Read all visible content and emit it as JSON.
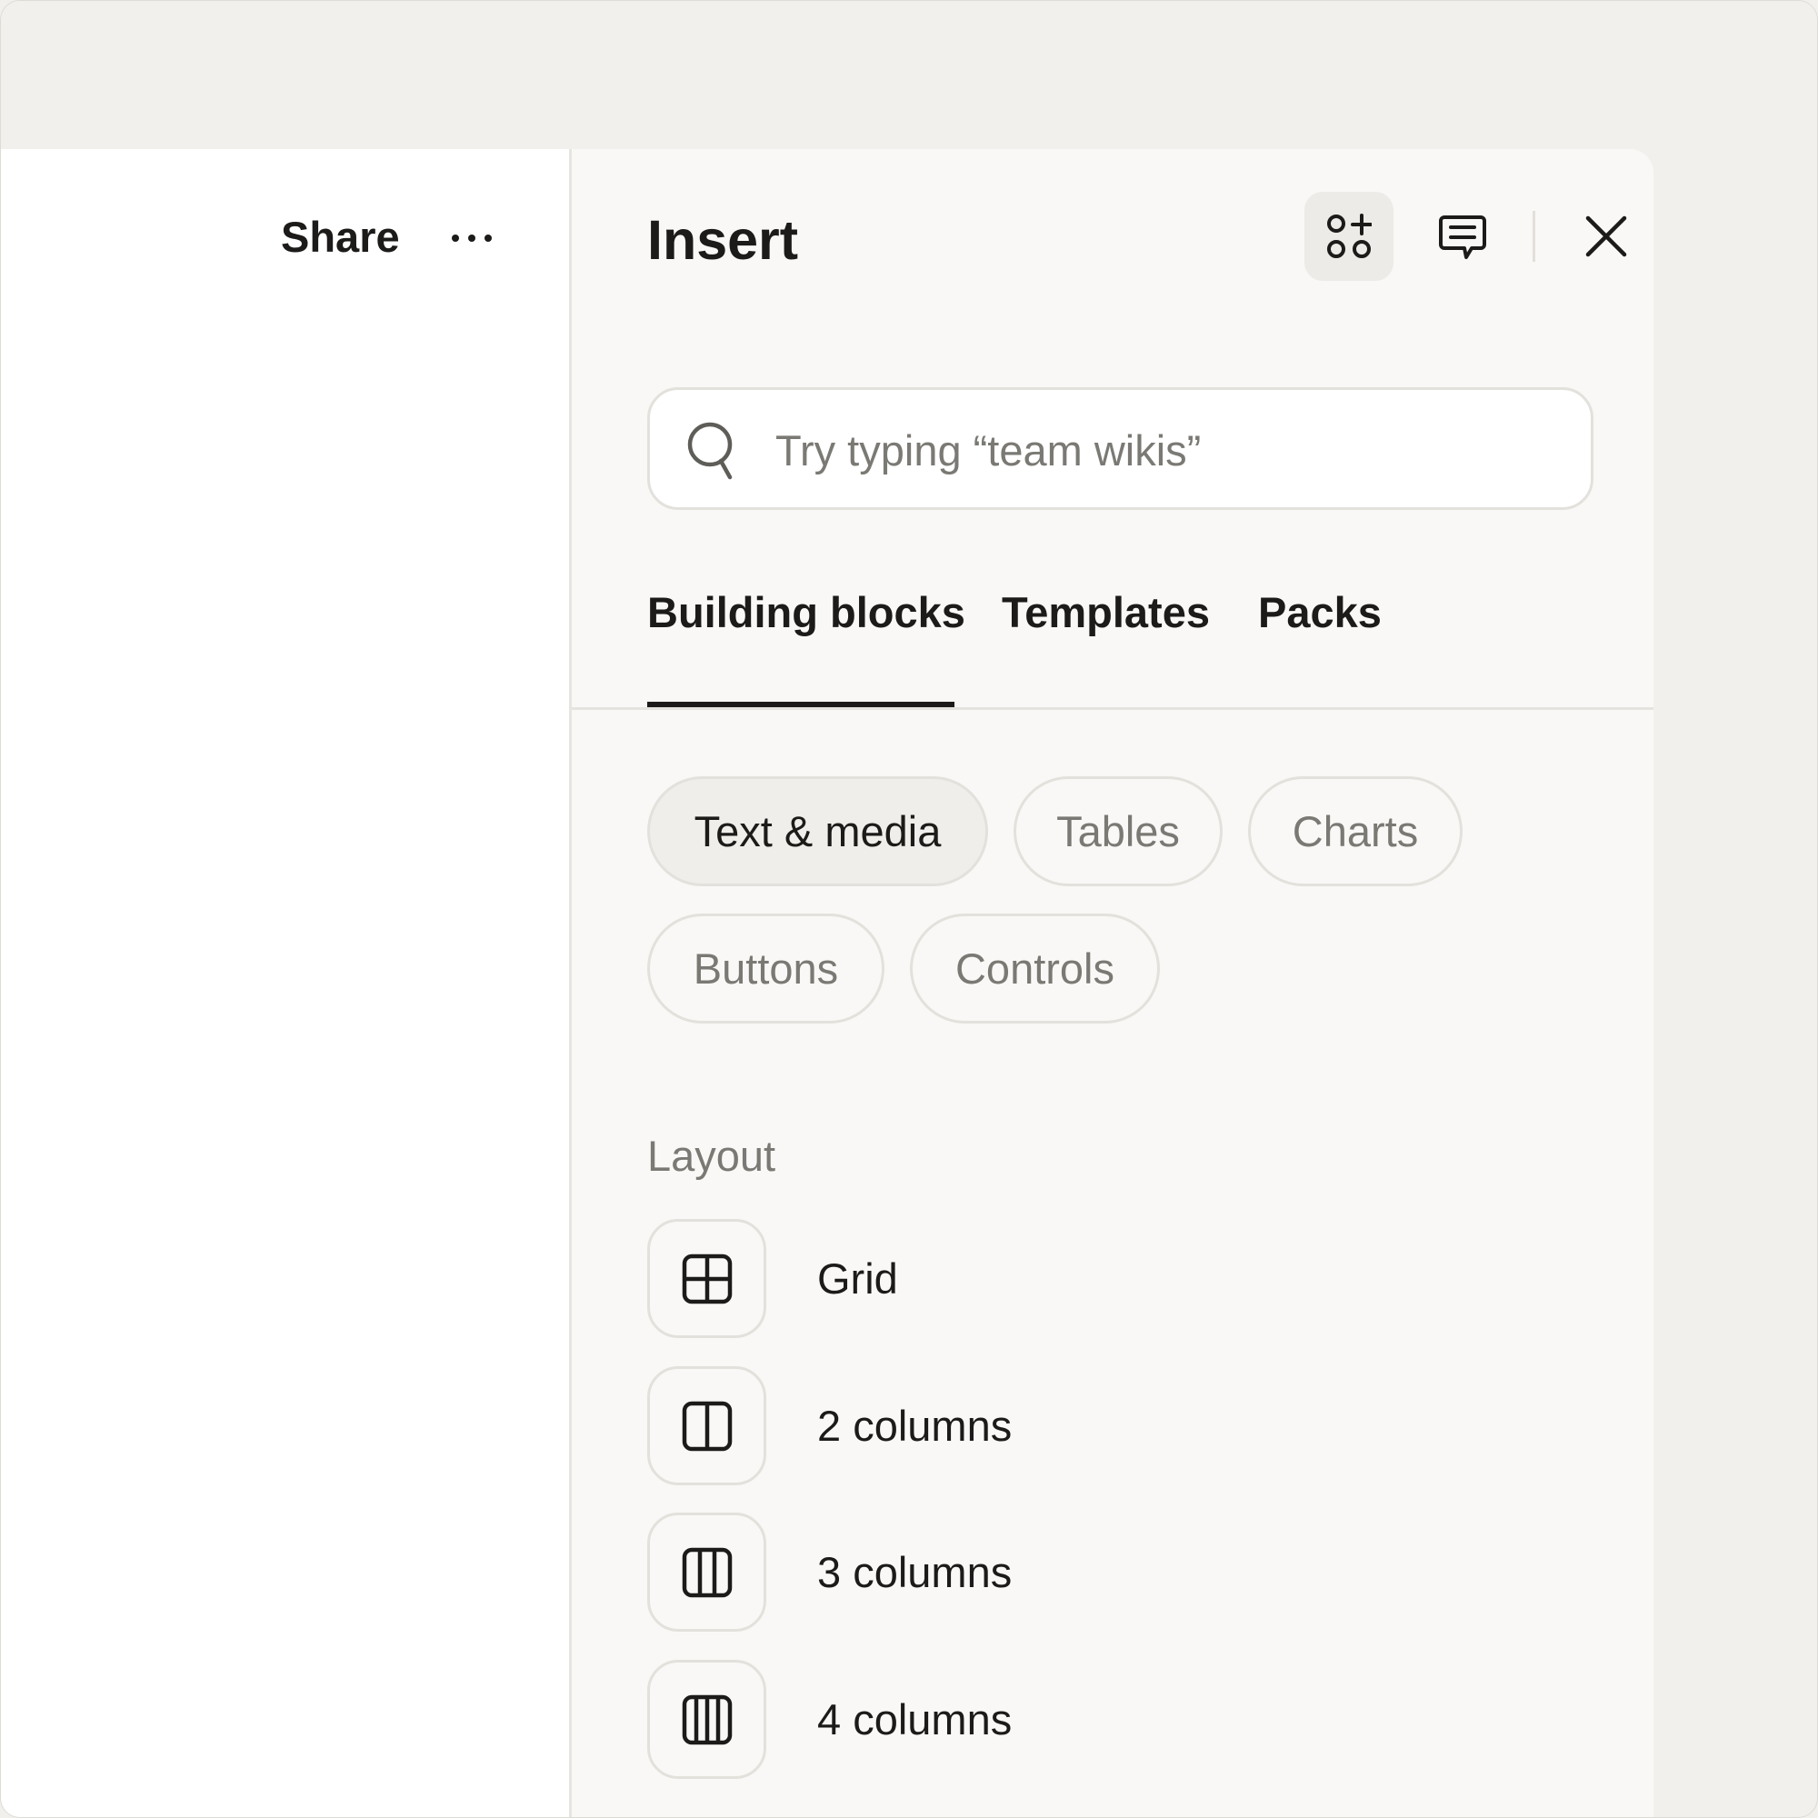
{
  "toolbar": {
    "share_label": "Share",
    "more_icon": "more-horizontal-icon"
  },
  "panel": {
    "title": "Insert",
    "header_icons": [
      "insert-blocks-icon",
      "comment-icon",
      "close-icon"
    ],
    "search": {
      "placeholder": "Try typing “team wikis”",
      "value": ""
    },
    "tabs": [
      {
        "label": "Building blocks",
        "active": true
      },
      {
        "label": "Templates",
        "active": false
      },
      {
        "label": "Packs",
        "active": false
      }
    ],
    "chips": [
      {
        "label": "Text & media",
        "selected": true
      },
      {
        "label": "Tables",
        "selected": false
      },
      {
        "label": "Charts",
        "selected": false
      },
      {
        "label": "Buttons",
        "selected": false
      },
      {
        "label": "Controls",
        "selected": false
      }
    ],
    "section": {
      "label": "Layout",
      "items": [
        {
          "label": "Grid",
          "icon": "grid-icon"
        },
        {
          "label": "2 columns",
          "icon": "two-columns-icon"
        },
        {
          "label": "3 columns",
          "icon": "three-columns-icon"
        },
        {
          "label": "4 columns",
          "icon": "four-columns-icon"
        }
      ]
    }
  }
}
